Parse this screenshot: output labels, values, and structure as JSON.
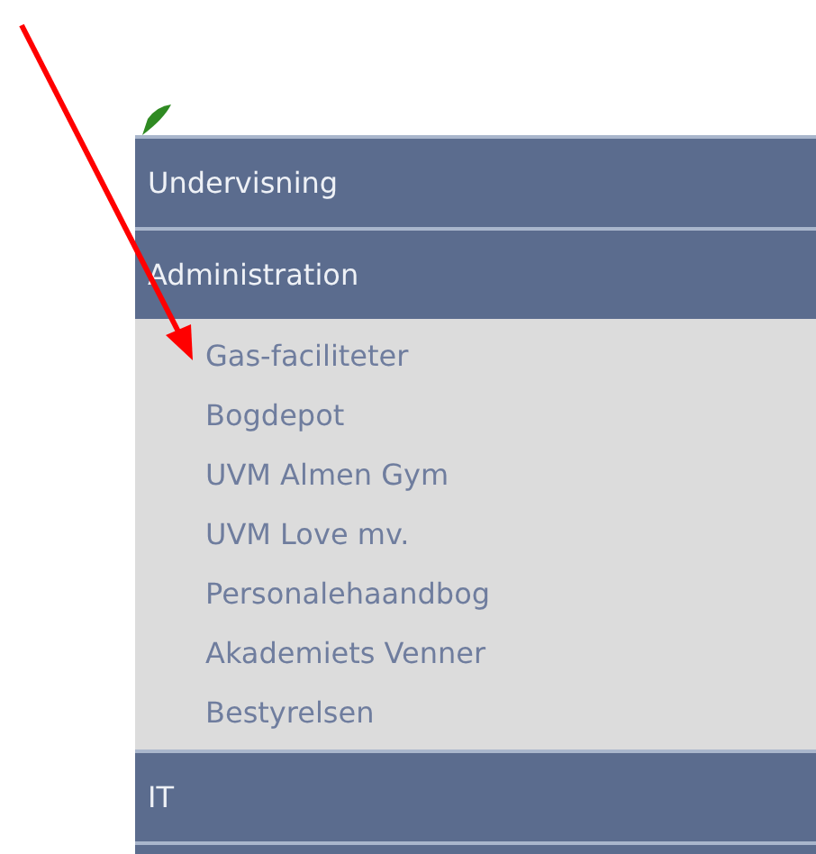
{
  "menu": [
    {
      "label": "Undervisning"
    },
    {
      "label": "Administration",
      "children": [
        {
          "label": "Gas-faciliteter"
        },
        {
          "label": "Bogdepot"
        },
        {
          "label": "UVM Almen Gym"
        },
        {
          "label": "UVM Love mv."
        },
        {
          "label": "Personalehaandbog"
        },
        {
          "label": "Akademiets Venner"
        },
        {
          "label": "Bestyrelsen"
        }
      ]
    },
    {
      "label": "IT"
    }
  ]
}
